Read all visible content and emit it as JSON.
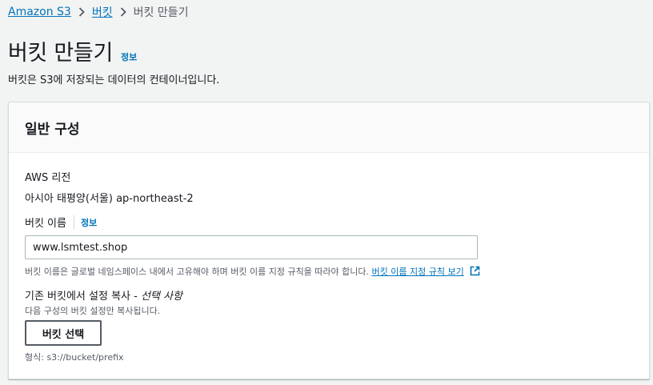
{
  "breadcrumb": {
    "items": [
      "Amazon S3",
      "버킷"
    ],
    "current": "버킷 만들기"
  },
  "header": {
    "title": "버킷 만들기",
    "info": "정보",
    "description": "버킷은 S3에 저장되는 데이터의 컨테이너입니다."
  },
  "panel": {
    "title": "일반 구성",
    "region_label": "AWS 리전",
    "region_value": "아시아 태평양(서울) ap-northeast-2",
    "bucket_name_label": "버킷 이름",
    "bucket_name_info": "정보",
    "bucket_name_value": "www.lsmtest.shop",
    "bucket_name_hint": "버킷 이름은 글로벌 네임스페이스 내에서 고유해야 하며 버킷 이름 지정 규칙을 따라야 합니다.",
    "bucket_name_rules_link": "버킷 이름 지정 규칙 보기",
    "copy_label": "기존 버킷에서 설정 복사 - ",
    "copy_optional": "선택 사항",
    "copy_desc": "다음 구성의 버킷 설정만 복사됩니다.",
    "choose_bucket_button": "버킷 선택",
    "format_hint": "형식: s3://bucket/prefix"
  },
  "icons": {
    "breadcrumb_separator": "chevron-right-icon",
    "external_link": "external-link-icon"
  },
  "colors": {
    "link": "#0073bb",
    "text": "#16191f",
    "muted": "#545b64",
    "background": "#f2f3f3"
  }
}
